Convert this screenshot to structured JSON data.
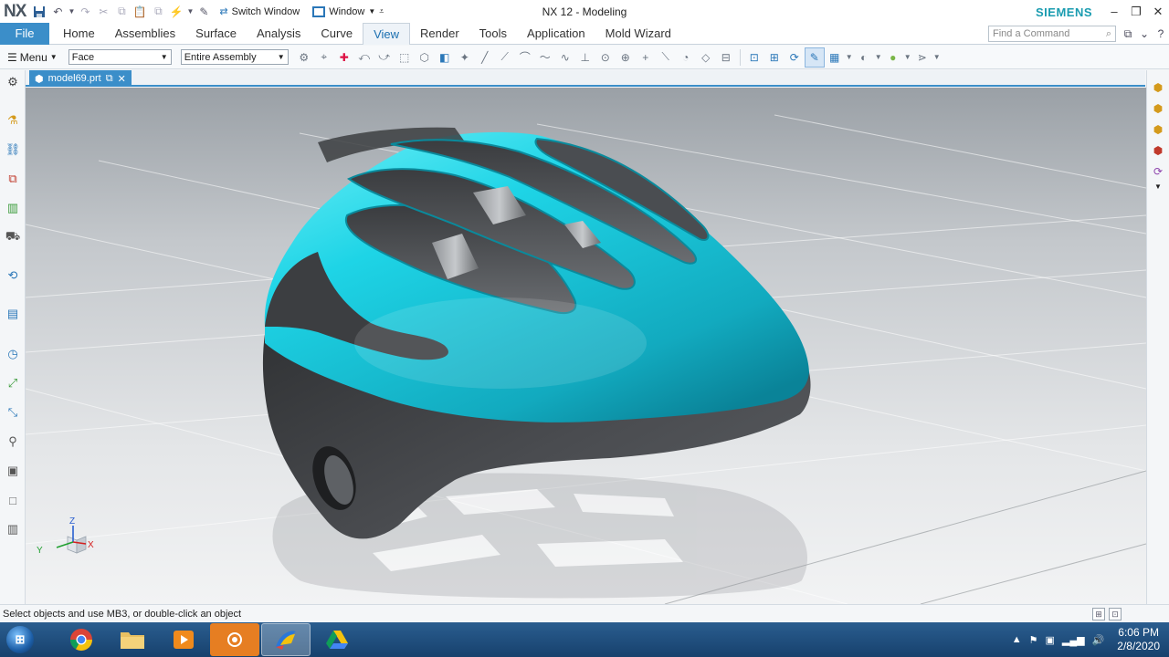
{
  "app": {
    "logo": "NX",
    "title": "NX 12 - Modeling",
    "brand": "SIEMENS",
    "switch_window_label": "Switch Window",
    "window_label": "Window"
  },
  "ribbon": {
    "file_label": "File",
    "tabs": [
      {
        "label": "Home"
      },
      {
        "label": "Assemblies"
      },
      {
        "label": "Surface"
      },
      {
        "label": "Analysis"
      },
      {
        "label": "Curve"
      },
      {
        "label": "View"
      },
      {
        "label": "Render"
      },
      {
        "label": "Tools"
      },
      {
        "label": "Application"
      },
      {
        "label": "Mold Wizard"
      }
    ],
    "active_tab": "View",
    "search_placeholder": "Find a Command"
  },
  "toolbar": {
    "menu_label": "Menu",
    "selection_filter": "Face",
    "scope": "Entire Assembly"
  },
  "document": {
    "tab_label": "model69.prt"
  },
  "viewport": {
    "model": "helmet",
    "accent_color": "#1ed4e6",
    "body_color": "#3c3e41",
    "triad_labels": {
      "x": "X",
      "y": "Y",
      "z": "Z"
    }
  },
  "status": {
    "prompt": "Select objects and use MB3, or double-click an object"
  },
  "taskbar": {
    "time": "6:06 PM",
    "date": "2/8/2020"
  }
}
